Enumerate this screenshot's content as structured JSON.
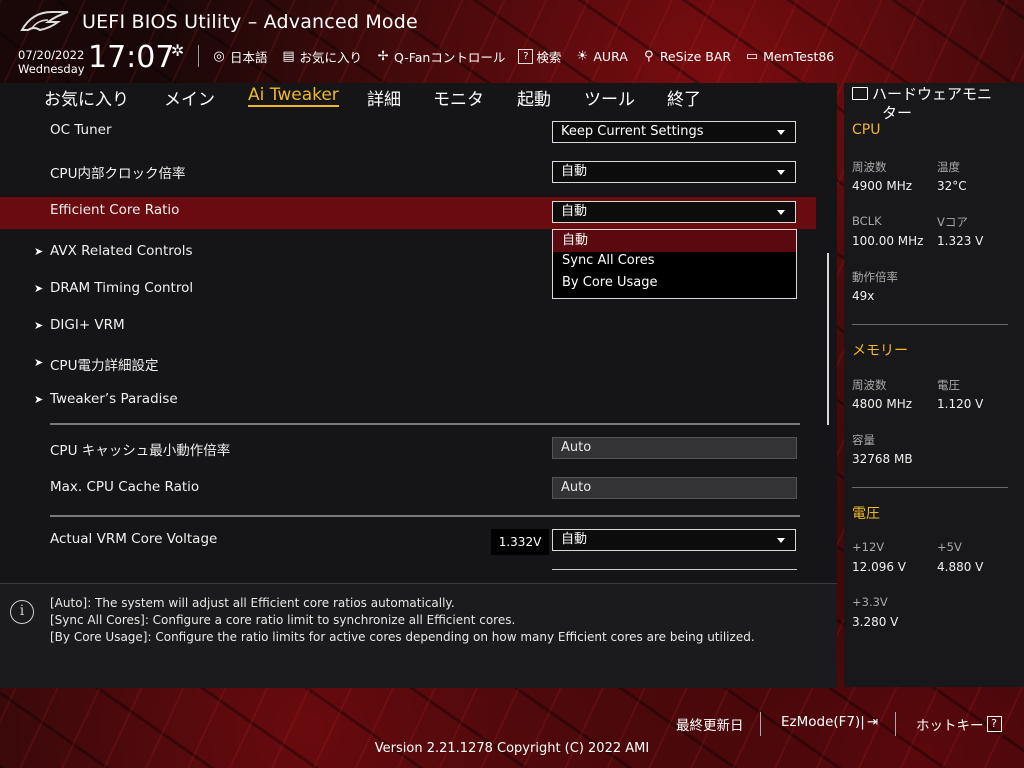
{
  "header": {
    "title": "UEFI BIOS Utility – Advanced Mode",
    "date": "07/20/2022",
    "weekday": "Wednesday",
    "time": "17:07",
    "toolbar": [
      {
        "label": "日本語",
        "icon": "globe-icon"
      },
      {
        "label": "お気に入り",
        "icon": "favorites-icon"
      },
      {
        "label": "Q-Fanコントロール",
        "icon": "fan-icon"
      },
      {
        "label": "検索",
        "icon": "search-icon"
      },
      {
        "label": "AURA",
        "icon": "aura-icon"
      },
      {
        "label": "ReSize BAR",
        "icon": "resize-bar-icon"
      },
      {
        "label": "MemTest86",
        "icon": "memtest-icon"
      }
    ]
  },
  "menu": {
    "tabs": [
      "お気に入り",
      "メイン",
      "Ai Tweaker",
      "詳細",
      "モニタ",
      "起動",
      "ツール",
      "終了"
    ],
    "active": "Ai Tweaker"
  },
  "settings": {
    "oc_tuner": {
      "label": "OC Tuner",
      "value": "Keep Current Settings"
    },
    "cpu_ratio": {
      "label": "CPU内部クロック倍率",
      "value": "自動"
    },
    "ecore_ratio": {
      "label": "Efficient Core Ratio",
      "value": "自動"
    },
    "dropdown_options": [
      "自動",
      "Sync All Cores",
      "By Core Usage"
    ],
    "submenus": [
      "AVX Related Controls",
      "DRAM Timing Control",
      "DIGI+ VRM",
      "CPU電力詳細設定",
      "Tweaker’s Paradise"
    ],
    "cache_min": {
      "label": "CPU キャッシュ最小動作倍率",
      "value": "Auto"
    },
    "cache_max": {
      "label": "Max. CPU Cache Ratio",
      "value": "Auto"
    },
    "vrm_voltage": {
      "label": "Actual VRM Core Voltage",
      "reading": "1.332V",
      "value": "自動"
    }
  },
  "help": {
    "lines": [
      "[Auto]: The system will adjust all Efficient core ratios automatically.",
      "[Sync All Cores]: Configure a core ratio limit to synchronize all Efficient cores.",
      "[By Core Usage]: Configure the ratio limits for active cores depending on how many Efficient cores are being utilized."
    ]
  },
  "hw_monitor": {
    "title_line1": "ハードウェアモニ",
    "title_line2": "ター",
    "cpu": {
      "section": "CPU",
      "freq_label": "周波数",
      "freq": "4900 MHz",
      "temp_label": "温度",
      "temp": "32°C",
      "bclk_label": "BCLK",
      "bclk": "100.00 MHz",
      "vcore_label": "Vコア",
      "vcore": "1.323 V",
      "ratio_label": "動作倍率",
      "ratio": "49x"
    },
    "memory": {
      "section": "メモリー",
      "freq_label": "周波数",
      "freq": "4800 MHz",
      "volt_label": "電圧",
      "volt": "1.120 V",
      "cap_label": "容量",
      "cap": "32768 MB"
    },
    "voltage": {
      "section": "電圧",
      "v12_label": "+12V",
      "v12": "12.096 V",
      "v5_label": "+5V",
      "v5": "4.880 V",
      "v33_label": "+3.3V",
      "v33": "3.280 V"
    }
  },
  "footer": {
    "last_modified": "最終更新日",
    "ezmode": "EzMode(F7)|",
    "hotkey": "ホットキー",
    "hotkey_key": "?",
    "version": "Version 2.21.1278 Copyright (C) 2022 AMI"
  },
  "colors": {
    "accent": "#f0b828",
    "highlight": "#6a0b0f",
    "background": "#151517"
  }
}
